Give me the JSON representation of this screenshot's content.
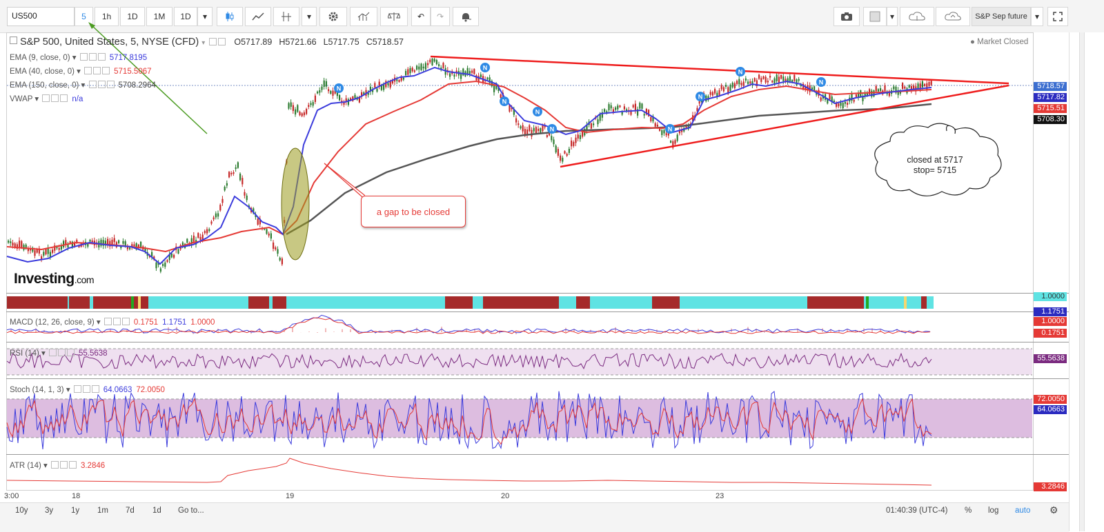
{
  "toolbar": {
    "symbol": "US500",
    "intervals": [
      "5",
      "1h",
      "1D",
      "1M",
      "1D"
    ],
    "active_interval": "5",
    "contract": "S&P Sep future"
  },
  "header": {
    "title": "S&P 500, United States, 5, NYSE (CFD)",
    "ohlc": {
      "o": "O5717.89",
      "h": "H5721.66",
      "l": "L5717.75",
      "c": "C5718.57"
    },
    "market_status": "Market Closed"
  },
  "indicators": {
    "ema9": {
      "label": "EMA (9, close, 0)",
      "value": "5717.8195"
    },
    "ema40": {
      "label": "EMA (40, close, 0)",
      "value": "5715.5067"
    },
    "ema150": {
      "label": "EMA (150, close, 0)",
      "value": "5708.2964"
    },
    "vwap": {
      "label": "VWAP",
      "value": "n/a"
    },
    "macd": {
      "label": "MACD (12, 26, close, 9)",
      "v1": "0.1751",
      "v2": "1.1751",
      "v3": "1.0000"
    },
    "rsi": {
      "label": "RSI (14)",
      "value": "55.5638"
    },
    "stoch": {
      "label": "Stoch (14, 1, 3)",
      "v1": "64.0663",
      "v2": "72.0050"
    },
    "atr": {
      "label": "ATR (14)",
      "value": "3.2846"
    }
  },
  "price_axis": {
    "last": "5718.57",
    "ema9": "5717.82",
    "ema40": "5715.51",
    "ema150": "5708.30",
    "strip": "1.0000",
    "macd_a": "1.1751",
    "macd_b": "1.0000",
    "macd_c": "0.1751",
    "rsi": "55.5638",
    "stoch_a": "72.0050",
    "stoch_b": "64.0663",
    "atr": "3.2846"
  },
  "time_axis": [
    "3:00",
    "18",
    "19",
    "20",
    "23"
  ],
  "annotations": {
    "gap": "a gap to be closed",
    "cloud_line1": "closed at 5717",
    "cloud_line2": "stop= 5715"
  },
  "watermark": {
    "brand": "Investing",
    "suffix": ".com"
  },
  "bottom_bar": {
    "ranges": [
      "10y",
      "3y",
      "1y",
      "1m",
      "7d",
      "1d"
    ],
    "goto": "Go to...",
    "clock": "01:40:39 (UTC-4)",
    "percent": "%",
    "log": "log",
    "auto": "auto"
  },
  "colors": {
    "ema9": "#3b3bdc",
    "ema40": "#e53935",
    "ema150": "#555555",
    "up": "#2e7d32",
    "down": "#c62828",
    "trend": "#ee1c1c",
    "rsi_fill": "#efe0f0",
    "stoch_fill": "#ddbde0"
  }
}
